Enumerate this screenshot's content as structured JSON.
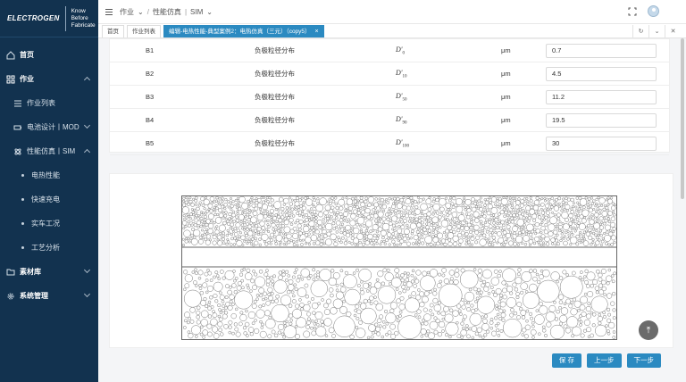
{
  "brand": {
    "logo": "ELECTROGEN",
    "tagline1": "Know",
    "tagline2": "Before",
    "tagline3": "Fabricate"
  },
  "sidebar": {
    "items": [
      {
        "label": "首页",
        "icon": "home-icon",
        "level": "group",
        "chevron": ""
      },
      {
        "label": "作业",
        "icon": "grid-icon",
        "level": "group",
        "chevron": "up"
      },
      {
        "label": "作业列表",
        "icon": "list-icon",
        "level": "sub",
        "chevron": ""
      },
      {
        "label": "电池设计丨MOD",
        "icon": "battery-icon",
        "level": "sub",
        "chevron": "down"
      },
      {
        "label": "性能仿真丨SIM",
        "icon": "atom-icon",
        "level": "sub",
        "chevron": "up"
      },
      {
        "label": "电热性能",
        "icon": "",
        "level": "leaf",
        "chevron": ""
      },
      {
        "label": "快速充电",
        "icon": "",
        "level": "leaf",
        "chevron": ""
      },
      {
        "label": "实车工况",
        "icon": "",
        "level": "leaf",
        "chevron": ""
      },
      {
        "label": "工艺分析",
        "icon": "",
        "level": "leaf",
        "chevron": ""
      },
      {
        "label": "素材库",
        "icon": "folder-icon",
        "level": "group",
        "chevron": "down"
      },
      {
        "label": "系统管理",
        "icon": "gear-icon",
        "level": "group",
        "chevron": "down"
      }
    ]
  },
  "header": {
    "crumb1": "作业",
    "crumb2": "性能仿真",
    "crumb3": "SIM"
  },
  "tabs": [
    {
      "label": "首页"
    },
    {
      "label": "作业列表"
    },
    {
      "label": "编辑-电热性能-典型案例2：电热仿真（三元）（copy5）"
    }
  ],
  "table": {
    "rows": [
      {
        "id": "B1",
        "name": "负极粒径分布",
        "sym": "D'",
        "sub": "0",
        "unit": "μm",
        "value": "0.7"
      },
      {
        "id": "B2",
        "name": "负极粒径分布",
        "sym": "D'",
        "sub": "10",
        "unit": "μm",
        "value": "4.5"
      },
      {
        "id": "B3",
        "name": "负极粒径分布",
        "sym": "D'",
        "sub": "50",
        "unit": "μm",
        "value": "11.2"
      },
      {
        "id": "B4",
        "name": "负极粒径分布",
        "sym": "D'",
        "sub": "90",
        "unit": "μm",
        "value": "19.5"
      },
      {
        "id": "B5",
        "name": "负极粒径分布",
        "sym": "D'",
        "sub": "100",
        "unit": "μm",
        "value": "30"
      }
    ]
  },
  "buttons": {
    "save": "保 存",
    "prev": "上一步",
    "next": "下一步"
  },
  "colors": {
    "sidebar_bg": "#12324f",
    "accent": "#2b8ac1"
  }
}
